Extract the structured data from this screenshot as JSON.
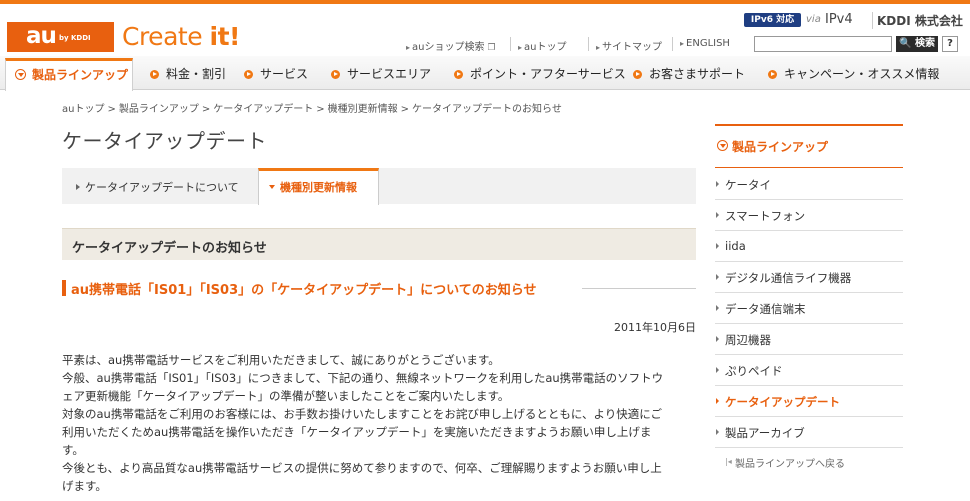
{
  "brand": {
    "logo_main": "au",
    "logo_sub": "by KDDI",
    "tagline_a": "Create ",
    "tagline_b": "it!"
  },
  "header_badges": {
    "ipv6": "IPv6 対応",
    "via": "via",
    "ipv4": "IPv4",
    "company": "KDDI 株式会社"
  },
  "utility_nav": [
    "auショップ検索",
    "auトップ",
    "サイトマップ",
    "ENGLISH"
  ],
  "search": {
    "placeholder": "",
    "button": "検索",
    "help": "?"
  },
  "global_nav": {
    "active": "製品ラインアップ",
    "items": [
      "料金・割引",
      "サービス",
      "サービスエリア",
      "ポイント・アフターサービス",
      "お客さまサポート",
      "キャンペーン・オススメ情報"
    ]
  },
  "breadcrumb": [
    "auトップ",
    "製品ラインアップ",
    "ケータイアップデート",
    "機種別更新情報",
    "ケータイアップデートのお知らせ"
  ],
  "page_title": "ケータイアップデート",
  "tabs": {
    "about": "ケータイアップデートについて",
    "model": "機種別更新情報"
  },
  "section_title": "ケータイアップデートのお知らせ",
  "notice": {
    "title": "au携帯電話「IS01」「IS03」の「ケータイアップデート」についてのお知らせ",
    "date": "2011年10月6日",
    "lines": [
      "平素は、au携帯電話サービスをご利用いただきまして、誠にありがとうございます。",
      "今般、au携帯電話「IS01」「IS03」につきまして、下記の通り、無線ネットワークを利用したau携帯電話のソフトウ",
      "ェア更新機能「ケータイアップデート」の準備が整いましたことをご案内いたします。",
      "対象のau携帯電話をご利用のお客様には、お手数お掛けいたしますことをお詫び申し上げるとともに、より快適にご",
      "利用いただくためau携帯電話を操作いただき「ケータイアップデート」を実施いただきますようお願い申し上げま",
      "す。",
      "今後とも、より高品質なau携帯電話サービスの提供に努めて参りますので、何卒、ご理解賜りますようお願い申し上",
      "げます。"
    ]
  },
  "sidebar": {
    "title": "製品ラインアップ",
    "items": [
      "ケータイ",
      "スマートフォン",
      "iida",
      "デジタル通信ライフ機器",
      "データ通信端末",
      "周辺機器",
      "ぷりペイド",
      "ケータイアップデート",
      "製品アーカイブ"
    ],
    "back": "製品ラインアップへ戻る"
  },
  "colors": {
    "accent": "#f07814",
    "navy": "#1f3e82"
  }
}
